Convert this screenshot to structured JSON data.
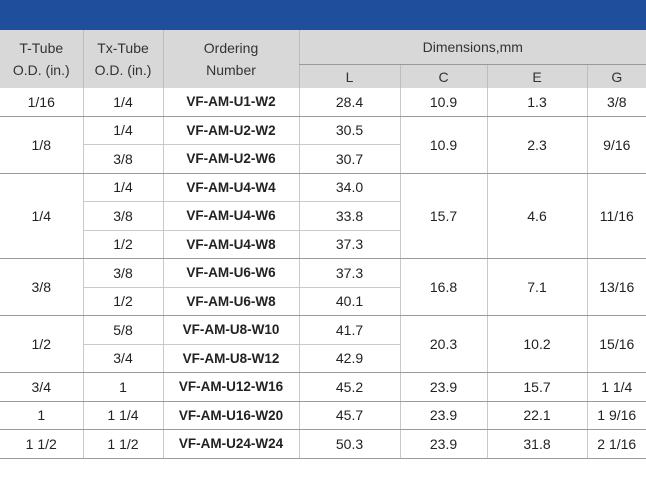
{
  "header": {
    "t_tube": [
      "T-Tube",
      "O.D. (in.)"
    ],
    "tx_tube": [
      "Tx-Tube",
      "O.D. (in.)"
    ],
    "ordering": [
      "Ordering",
      "Number"
    ],
    "dimensions": "Dimensions,mm",
    "cols": [
      "L",
      "C",
      "E",
      "G"
    ]
  },
  "rows": [
    {
      "t": "1/16",
      "tx": "1/4",
      "code": "VF-AM-U1-W2",
      "L": "28.4",
      "C": "10.9",
      "E": "1.3",
      "G": "3/8"
    },
    {
      "t": "1/8",
      "tx": "1/4",
      "code": "VF-AM-U2-W2",
      "L": "30.5",
      "C": "10.9",
      "E": "2.3",
      "G": "9/16"
    },
    {
      "tx": "3/8",
      "code": "VF-AM-U2-W6",
      "L": "30.7"
    },
    {
      "t": "1/4",
      "tx": "1/4",
      "code": "VF-AM-U4-W4",
      "L": "34.0",
      "C": "15.7",
      "E": "4.6",
      "G": "11/16"
    },
    {
      "tx": "3/8",
      "code": "VF-AM-U4-W6",
      "L": "33.8"
    },
    {
      "tx": "1/2",
      "code": "VF-AM-U4-W8",
      "L": "37.3"
    },
    {
      "t": "3/8",
      "tx": "3/8",
      "code": "VF-AM-U6-W6",
      "L": "37.3",
      "C": "16.8",
      "E": "7.1",
      "G": "13/16"
    },
    {
      "tx": "1/2",
      "code": "VF-AM-U6-W8",
      "L": "40.1"
    },
    {
      "t": "1/2",
      "tx": "5/8",
      "code": "VF-AM-U8-W10",
      "L": "41.7",
      "C": "20.3",
      "E": "10.2",
      "G": "15/16"
    },
    {
      "tx": "3/4",
      "code": "VF-AM-U8-W12",
      "L": "42.9"
    },
    {
      "t": "3/4",
      "tx": "1",
      "code": "VF-AM-U12-W16",
      "L": "45.2",
      "C": "23.9",
      "E": "15.7",
      "G": "1 1/4"
    },
    {
      "t": "1",
      "tx": "1 1/4",
      "code": "VF-AM-U16-W20",
      "L": "45.7",
      "C": "23.9",
      "E": "22.1",
      "G": "1 9/16"
    },
    {
      "t": "1 1/2",
      "tx": "1 1/2",
      "code": "VF-AM-U24-W24",
      "L": "50.3",
      "C": "23.9",
      "E": "31.8",
      "G": "2 1/16"
    }
  ]
}
